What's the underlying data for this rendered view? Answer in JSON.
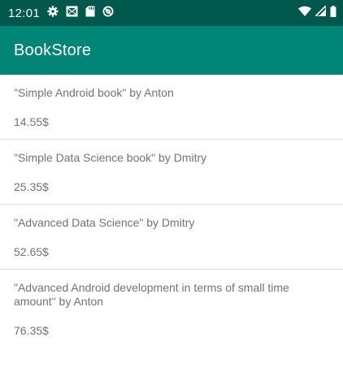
{
  "status_bar": {
    "time": "12:01",
    "left_icons": [
      "gear-icon",
      "mail-notification-icon",
      "sd-card-icon",
      "blocked-icon"
    ],
    "right_icons": [
      "wifi-icon",
      "cell-signal-icon",
      "battery-icon"
    ]
  },
  "app_bar": {
    "title": "BookStore",
    "color": "#008577",
    "status_color": "#00584d"
  },
  "books": [
    {
      "title": "\"Simple Android book\" by Anton",
      "price": "14.55$"
    },
    {
      "title": "\"Simple Data Science book\" by Dmitry",
      "price": "25.35$"
    },
    {
      "title": "\"Advanced Data Science\" by Dmitry",
      "price": "52.65$"
    },
    {
      "title": "\"Advanced Android development in terms of small time amount\" by Anton",
      "price": "76.35$"
    }
  ]
}
